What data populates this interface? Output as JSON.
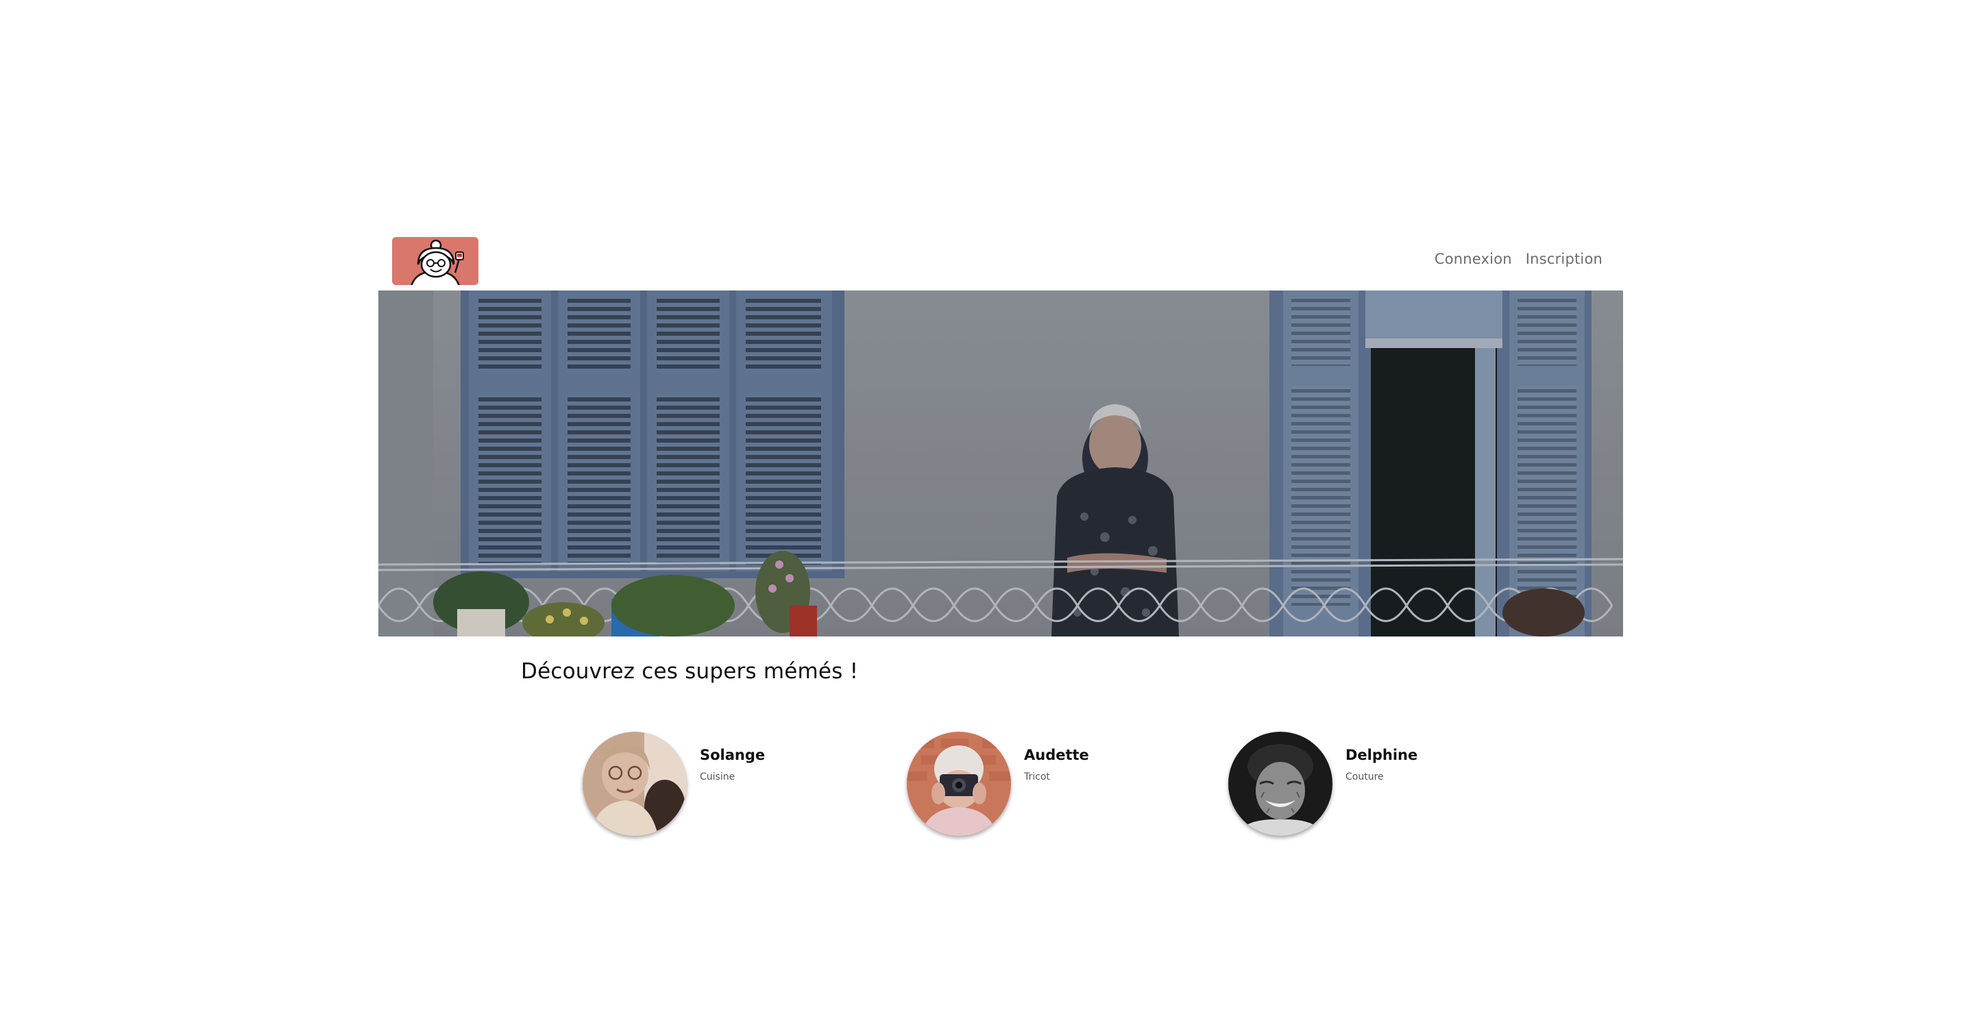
{
  "header": {
    "logo_alt": "grandma logo",
    "nav": {
      "login_label": "Connexion",
      "signup_label": "Inscription"
    }
  },
  "hero": {
    "image": "grandmother leaning on balcony railing"
  },
  "main": {
    "title": "Découvrez ces supers mémés !",
    "profiles": [
      {
        "name": "Solange",
        "skill": "Cuisine"
      },
      {
        "name": "Audette",
        "skill": "Tricot"
      },
      {
        "name": "Delphine",
        "skill": "Couture"
      }
    ]
  },
  "colors": {
    "logo_bg": "#d9776d",
    "nav_text": "#6c6c6c",
    "title_text": "#111111"
  }
}
